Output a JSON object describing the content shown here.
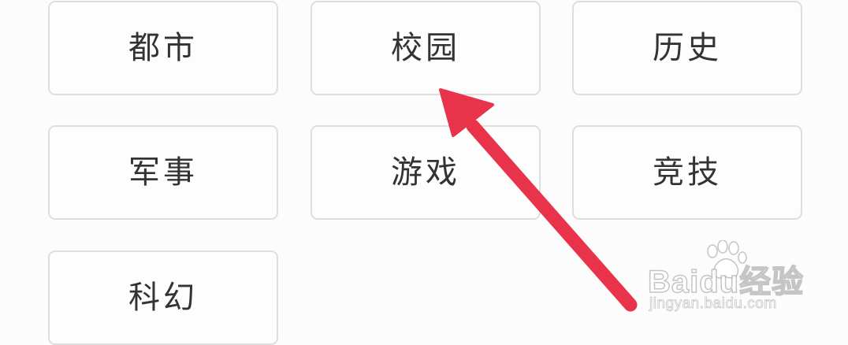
{
  "genres": [
    {
      "label": "都市"
    },
    {
      "label": "校园"
    },
    {
      "label": "历史"
    },
    {
      "label": "军事"
    },
    {
      "label": "游戏"
    },
    {
      "label": "竞技"
    },
    {
      "label": "科幻"
    }
  ],
  "annotation": {
    "arrow_color": "#e8334a",
    "points_to": "校园"
  },
  "watermark": {
    "logo_text": "Baidu经验",
    "url": "jingyan.baidu.com"
  },
  "colors": {
    "background": "#fcfcfc",
    "tile_border": "#dedede",
    "tile_text": "#333333"
  }
}
